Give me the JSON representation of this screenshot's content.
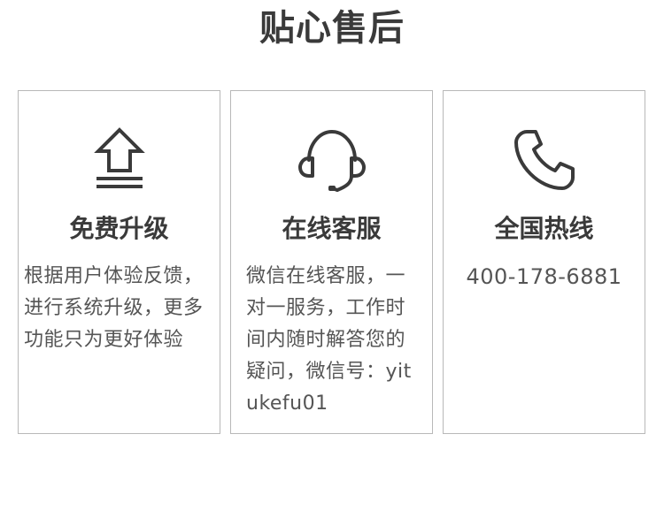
{
  "header": {
    "title": "贴心售后"
  },
  "cards": [
    {
      "icon": "upgrade-arrow-icon",
      "title": "免费升级",
      "description": "根据用户体验反馈，进行系统升级，更多功能只为更好体验"
    },
    {
      "icon": "headset-icon",
      "title": "在线客服",
      "description": "微信在线客服，一对一服务，工作时间内随时解答您的疑问，微信号：yitukefu01"
    },
    {
      "icon": "phone-icon",
      "title": "全国热线",
      "phone": "400-178-6881"
    }
  ],
  "colors": {
    "text": "#3a3a3a",
    "body_text": "#555555",
    "border": "#b8b8b8",
    "icon": "#3a3a3a"
  }
}
